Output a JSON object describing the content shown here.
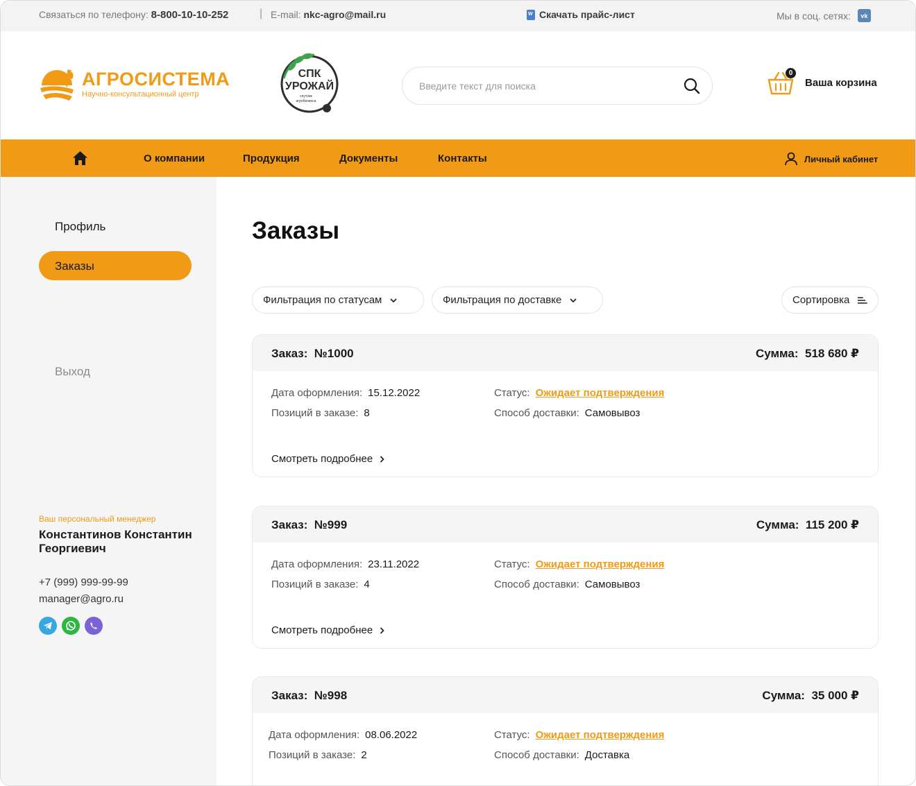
{
  "topbar": {
    "phone_label": "Связаться по телефону:",
    "phone": "8-800-10-10-252",
    "email_label": "E-mail:",
    "email": "nkc-agro@mail.ru",
    "price_list": "Скачать прайс-лист",
    "social_label": "Мы в соц. сетях:",
    "social_icon": "vk-icon"
  },
  "header": {
    "logo_name": "АГРОСИСТЕМА",
    "logo_sub": "Научно-консультационный центр",
    "partner_line1": "СПК",
    "partner_line2": "УРОЖАЙ",
    "partner_line3": "спутник",
    "partner_line4": "агробизнеса",
    "search_placeholder": "Введите текст для поиска",
    "cart_count": "0",
    "cart_label": "Ваша корзина"
  },
  "nav": {
    "items": [
      "О компании",
      "Продукция",
      "Документы",
      "Контакты"
    ],
    "account": "Личный кабинет"
  },
  "sidebar": {
    "profile": "Профиль",
    "orders": "Заказы",
    "exit": "Выход",
    "manager_label": "Ваш персональный менеджер",
    "manager_name": "Константинов Константин Георгиевич",
    "manager_phone": "+7 (999) 999-99-99",
    "manager_email": "manager@agro.ru",
    "messengers": [
      "telegram-icon",
      "whatsapp-icon",
      "viber-icon"
    ]
  },
  "main": {
    "title": "Заказы",
    "filter_status": "Фильтрация по статусам",
    "filter_delivery": "Фильтрация по доставке",
    "sort": "Сортировка",
    "order_label": "Заказ:",
    "sum_label": "Сумма:",
    "date_label": "Дата оформления:",
    "positions_label": "Позиций в заказе:",
    "status_label": "Статус:",
    "delivery_label": "Способ доставки:",
    "more_label": "Смотреть подробнее",
    "orders": [
      {
        "number": "№1000",
        "sum": "518 680 ₽",
        "date": "15.12.2022",
        "positions": "8",
        "status": "Ожидает подтверждения",
        "delivery": "Самовывоз"
      },
      {
        "number": "№999",
        "sum": "115 200 ₽",
        "date": "23.11.2022",
        "positions": "4",
        "status": "Ожидает подтверждения",
        "delivery": "Самовывоз"
      },
      {
        "number": "№998",
        "sum": "35 000 ₽",
        "date": "08.06.2022",
        "positions": "2",
        "status": "Ожидает подтверждения",
        "delivery": "Доставка"
      }
    ]
  },
  "colors": {
    "accent": "#f09a16",
    "sidebar_bg": "#f5f5f5",
    "topbar_bg": "#f3f3f3"
  }
}
